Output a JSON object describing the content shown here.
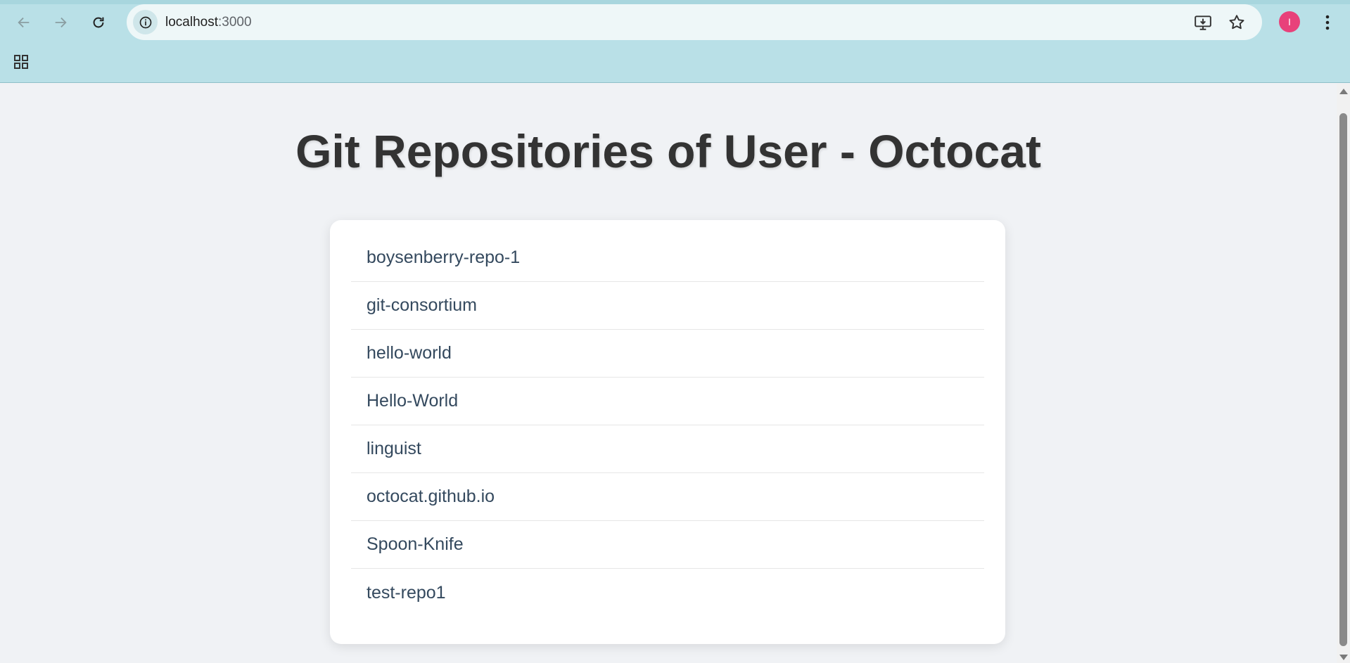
{
  "browser": {
    "url_host": "localhost",
    "url_port": ":3000",
    "profile_initial": "I",
    "colors": {
      "chrome": "#b9e0e7",
      "avatar": "#e8417a"
    }
  },
  "page": {
    "title": "Git Repositories of User - Octocat",
    "repos": [
      "boysenberry-repo-1",
      "git-consortium",
      "hello-world",
      "Hello-World",
      "linguist",
      "octocat.github.io",
      "Spoon-Knife",
      "test-repo1"
    ]
  }
}
